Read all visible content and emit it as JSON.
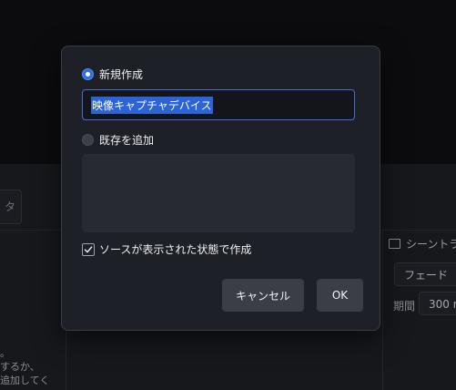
{
  "background": {
    "left_button_text": "タ",
    "scene_panel_title": "シーントラ",
    "transition_value": "フェード",
    "duration_label": "期間",
    "duration_value": "300 m",
    "left_help_text": "。\nするか、\n追加してく"
  },
  "dialog": {
    "option_new_label": "新規作成",
    "name_input_value": "映像キャプチャデバイス",
    "option_existing_label": "既存を追加",
    "existing_sources": [],
    "make_visible_label": "ソースが表示された状態で作成",
    "make_visible_checked": true,
    "cancel_label": "キャンセル",
    "ok_label": "OK"
  },
  "colors": {
    "accent": "#2f6fe0",
    "dialog_bg": "#1e2027",
    "button_bg": "#3b3d47"
  }
}
